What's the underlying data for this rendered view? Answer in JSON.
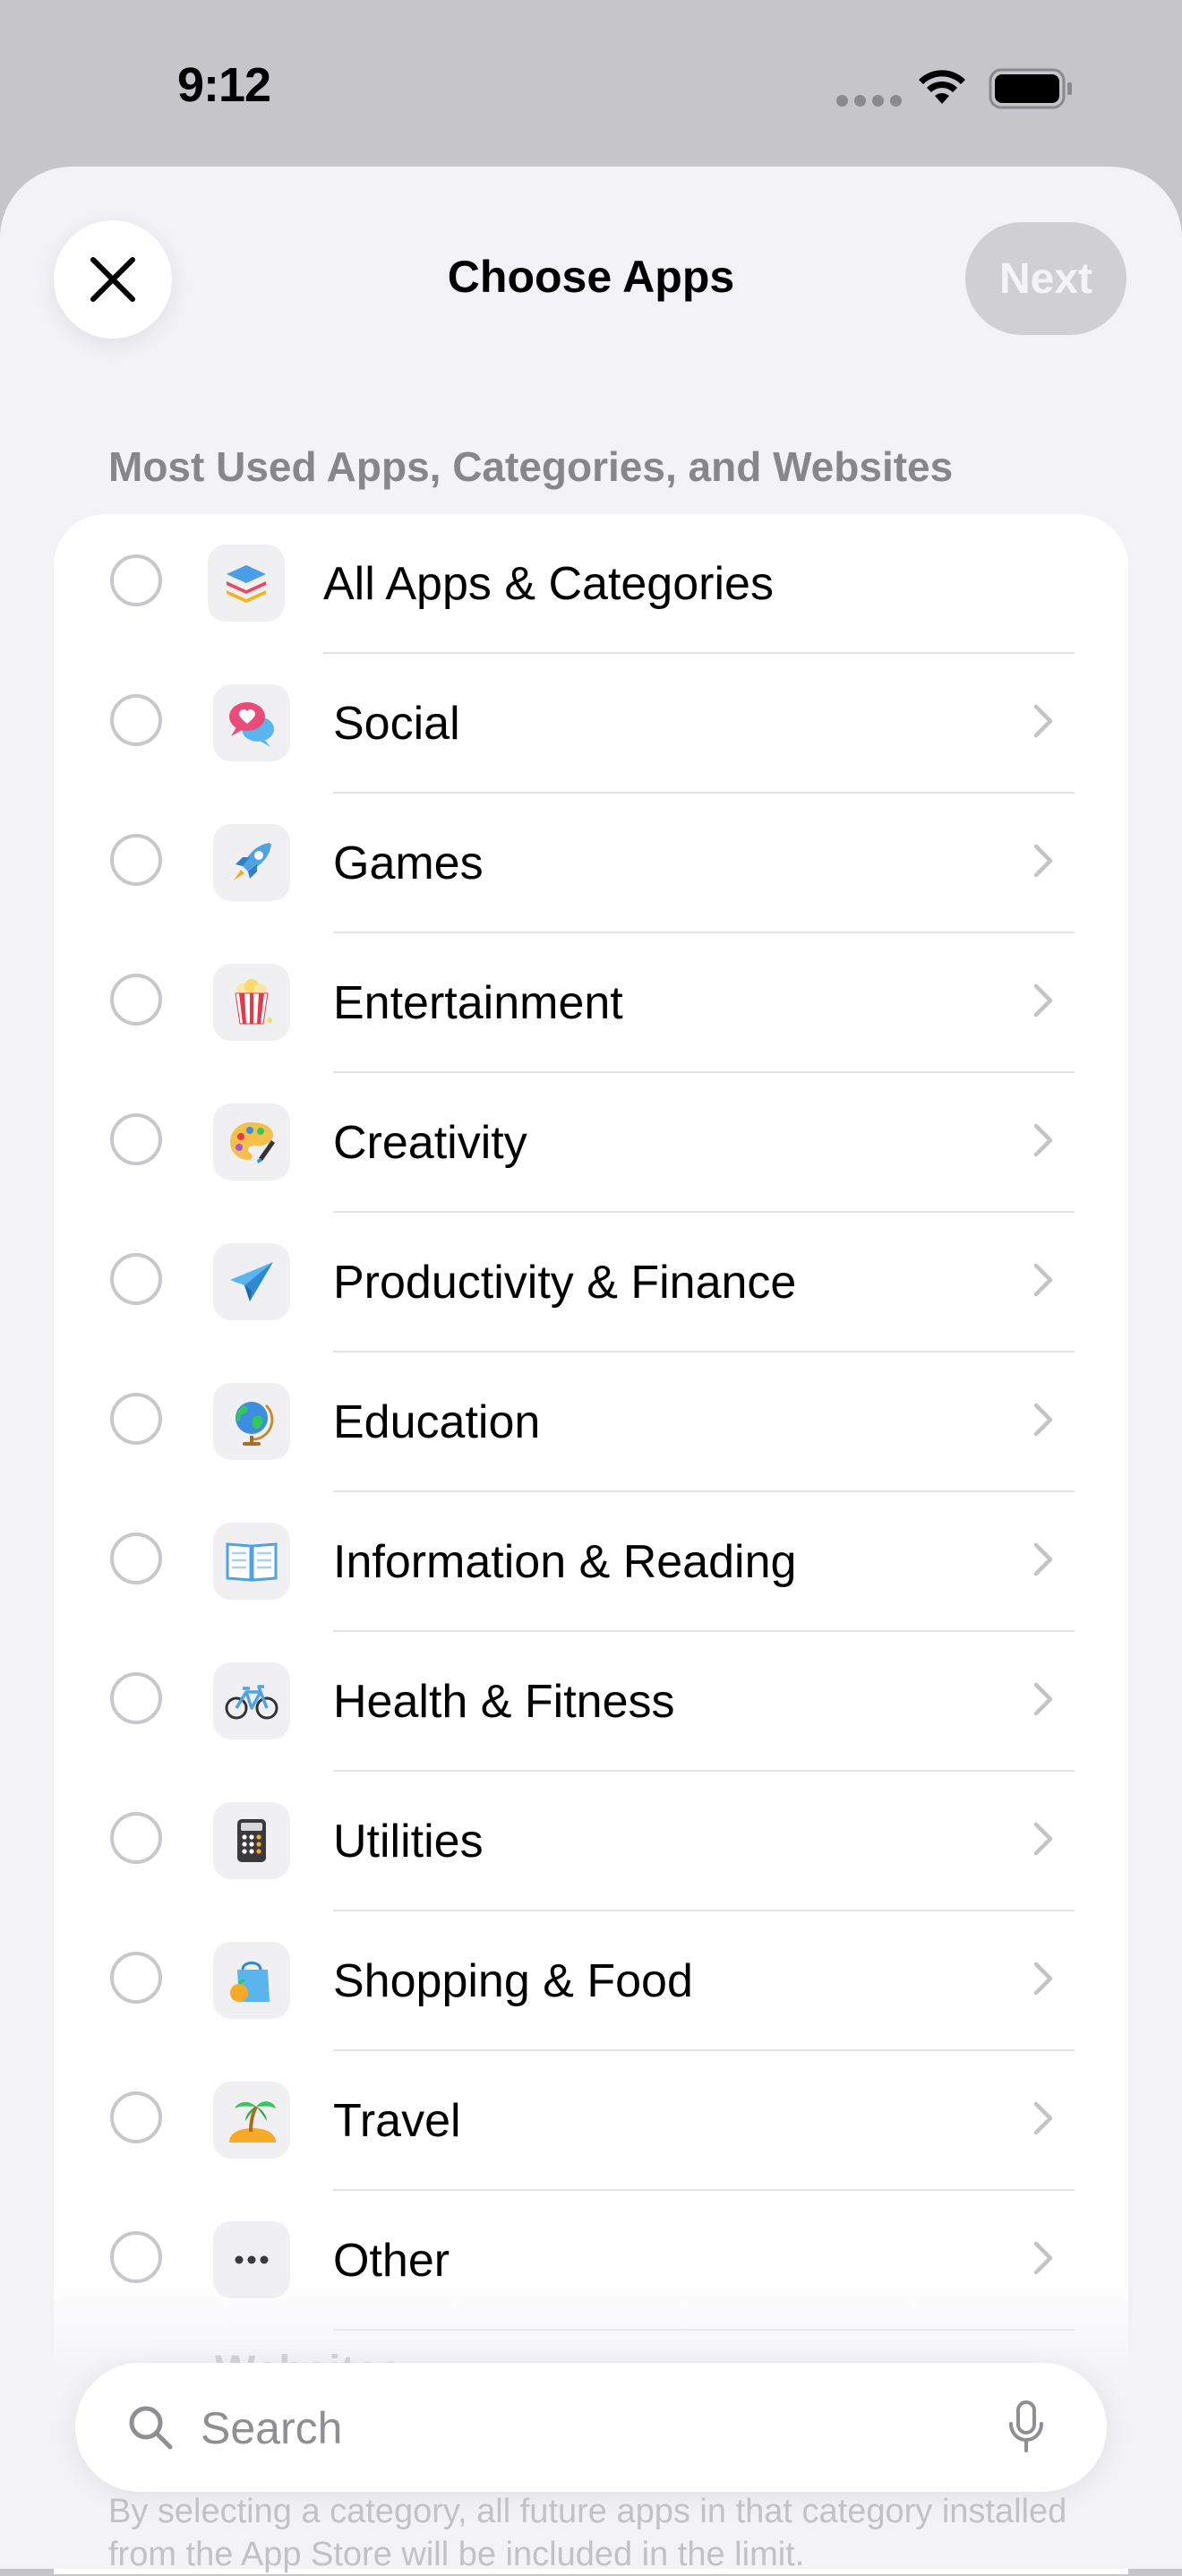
{
  "status_bar": {
    "time": "9:12"
  },
  "header": {
    "title": "Choose Apps",
    "next_label": "Next"
  },
  "section_header": "Most Used Apps, Categories, and Websites",
  "rows": [
    {
      "label": "All Apps & Categories",
      "icon": "stack-icon",
      "has_chevron": false
    },
    {
      "label": "Social",
      "icon": "speech-bubbles-icon",
      "has_chevron": true
    },
    {
      "label": "Games",
      "icon": "rocket-icon",
      "has_chevron": true
    },
    {
      "label": "Entertainment",
      "icon": "popcorn-icon",
      "has_chevron": true
    },
    {
      "label": "Creativity",
      "icon": "palette-icon",
      "has_chevron": true
    },
    {
      "label": "Productivity & Finance",
      "icon": "paper-plane-icon",
      "has_chevron": true
    },
    {
      "label": "Education",
      "icon": "globe-icon",
      "has_chevron": true
    },
    {
      "label": "Information & Reading",
      "icon": "book-icon",
      "has_chevron": true
    },
    {
      "label": "Health & Fitness",
      "icon": "bicycle-icon",
      "has_chevron": true
    },
    {
      "label": "Utilities",
      "icon": "calculator-icon",
      "has_chevron": true
    },
    {
      "label": "Shopping & Food",
      "icon": "shopping-bag-icon",
      "has_chevron": true
    },
    {
      "label": "Travel",
      "icon": "palm-tree-icon",
      "has_chevron": true
    },
    {
      "label": "Other",
      "icon": "ellipsis-icon",
      "has_chevron": true
    }
  ],
  "partial_row_label": "Websites",
  "search": {
    "placeholder": "Search"
  },
  "footer_note": "By selecting a category, all future apps in that category installed from the App Store will be included in the limit."
}
